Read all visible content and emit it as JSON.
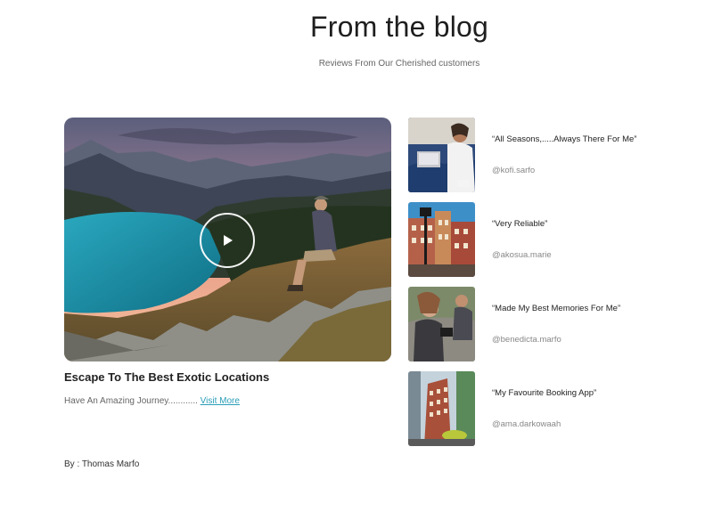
{
  "header": {
    "title": "From the blog",
    "subtitle": "Reviews From Our Cherished customers"
  },
  "featured": {
    "image_icon": "landscape-photo",
    "play_icon": "play-icon",
    "title": "Escape To The Best Exotic Locations",
    "excerpt": "Have An Amazing Journey............",
    "link_label": "Visit More",
    "author": "By : Thomas Marfo"
  },
  "reviews": [
    {
      "quote": "“All Seasons,.....Always There For Me”",
      "handle": "@kofi.sarfo"
    },
    {
      "quote": "“Very Reliable”",
      "handle": "@akosua.marie"
    },
    {
      "quote": "“Made My Best Memories For Me”",
      "handle": "@benedicta.marfo"
    },
    {
      "quote": "“My Favourite Booking App”",
      "handle": "@ama.darkowaah"
    }
  ],
  "colors": {
    "link": "#2a9db7",
    "lake": "#1f8fa3"
  }
}
